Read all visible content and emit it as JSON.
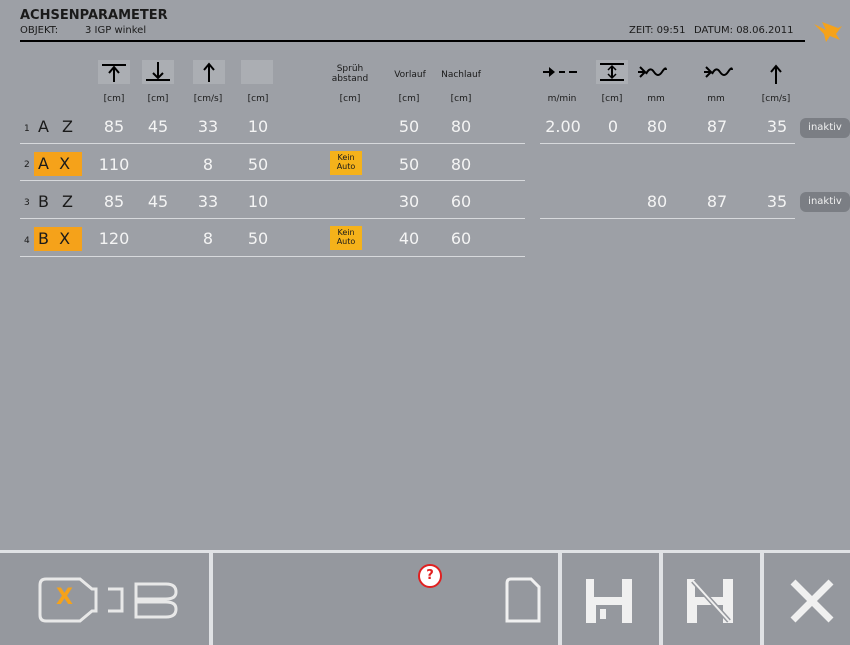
{
  "header": {
    "title": "ACHSENPARAMETER",
    "objekt_label": "OBJEKT:",
    "objekt_value": "3 IGP winkel",
    "zeit": "ZEIT: 09:51",
    "datum": "DATUM: 08.06.2011"
  },
  "columns": {
    "units": [
      "[cm]",
      "[cm]",
      "[cm/s]",
      "[cm]",
      "[cm]",
      "[cm]",
      "[cm]",
      "m/min",
      "[cm]",
      "mm",
      "mm",
      "[cm/s]"
    ],
    "spruh": "Sprüh\nabstand",
    "spruh_l1": "Sprüh",
    "spruh_l2": "abstand",
    "vorlauf": "Vorlauf",
    "nachlauf": "Nachlauf"
  },
  "rows": [
    {
      "num": "1",
      "label1": "A",
      "label2": "Z",
      "highlight": false,
      "v1": "85",
      "v2": "45",
      "v3": "33",
      "v4": "10",
      "kein": "",
      "vorlauf": "50",
      "nachlauf": "80",
      "e1": "2.00",
      "e2": "0",
      "e3": "80",
      "e4": "87",
      "e5": "35",
      "status": "inaktiv"
    },
    {
      "num": "2",
      "label1": "A",
      "label2": "X",
      "highlight": true,
      "v1": "110",
      "v2": "",
      "v3": "8",
      "v4": "50",
      "kein": "Kein Auto",
      "kein_l1": "Kein",
      "kein_l2": "Auto",
      "vorlauf": "50",
      "nachlauf": "80",
      "e1": "",
      "e2": "",
      "e3": "",
      "e4": "",
      "e5": "",
      "status": ""
    },
    {
      "num": "3",
      "label1": "B",
      "label2": "Z",
      "highlight": false,
      "v1": "85",
      "v2": "45",
      "v3": "33",
      "v4": "10",
      "kein": "",
      "vorlauf": "30",
      "nachlauf": "60",
      "e1": "",
      "e2": "",
      "e3": "80",
      "e4": "87",
      "e5": "35",
      "status": "inaktiv"
    },
    {
      "num": "4",
      "label1": "B",
      "label2": "X",
      "highlight": true,
      "v1": "120",
      "v2": "",
      "v3": "8",
      "v4": "50",
      "kein": "Kein Auto",
      "kein_l1": "Kein",
      "kein_l2": "Auto",
      "vorlauf": "40",
      "nachlauf": "60",
      "e1": "",
      "e2": "",
      "e3": "",
      "e4": "",
      "e5": "",
      "status": ""
    }
  ],
  "toolbar": {
    "axis_selector_label": "X",
    "help_symbol": "?"
  },
  "colors": {
    "background": "#9da0a6",
    "accent": "#f5a21a",
    "help_red": "#e02020"
  }
}
